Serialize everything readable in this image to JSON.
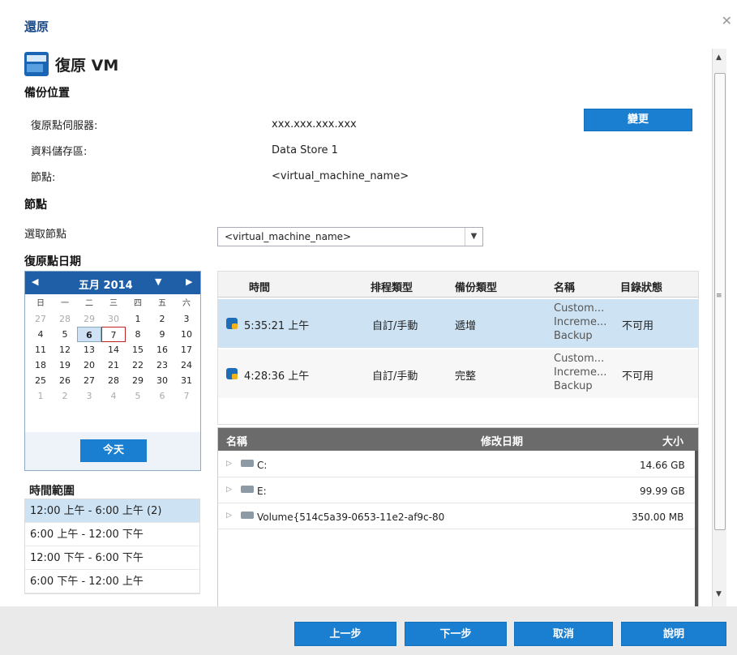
{
  "window": {
    "title": "還原",
    "close_glyph": "✕"
  },
  "header": {
    "title": "復原 VM",
    "icon": "vm-restore-icon"
  },
  "backup_location": {
    "section_title": "備份位置",
    "server_label": "復原點伺服器:",
    "server_value": "xxx.xxx.xxx.xxx",
    "datastore_label": "資料儲存區:",
    "datastore_value": "Data Store 1",
    "node_label": "節點:",
    "node_value": "<virtual_machine_name>",
    "change_button": "變更"
  },
  "node": {
    "section_title": "節點",
    "select_label": "選取節點",
    "selected_value": "<virtual_machine_name>"
  },
  "recovery_date": {
    "section_title": "復原點日期",
    "month_label": "五月 2014",
    "prev_glyph": "◀",
    "next_glyph": "▶",
    "dropdown_glyph": "▼",
    "weekdays": [
      "日",
      "一",
      "二",
      "三",
      "四",
      "五",
      "六"
    ],
    "weeks": [
      [
        "27",
        "28",
        "29",
        "30",
        "1",
        "2",
        "3"
      ],
      [
        "4",
        "5",
        "6",
        "7",
        "8",
        "9",
        "10"
      ],
      [
        "11",
        "12",
        "13",
        "14",
        "15",
        "16",
        "17"
      ],
      [
        "18",
        "19",
        "20",
        "21",
        "22",
        "23",
        "24"
      ],
      [
        "25",
        "26",
        "27",
        "28",
        "29",
        "30",
        "31"
      ],
      [
        "1",
        "2",
        "3",
        "4",
        "5",
        "6",
        "7"
      ]
    ],
    "selected_day": "6",
    "today_day": "7",
    "today_button": "今天"
  },
  "time_range": {
    "title": "時間範圍",
    "items": [
      "12:00 上午 - 6:00 上午  (2)",
      "6:00 上午 - 12:00 下午",
      "12:00 下午 - 6:00 下午",
      "6:00 下午 - 12:00 上午"
    ]
  },
  "recovery_points": {
    "columns": [
      "時間",
      "排程類型",
      "備份類型",
      "名稱",
      "目錄狀態"
    ],
    "rows": [
      {
        "time": "5:35:21 上午",
        "schedule": "自訂/手動",
        "backup_type": "遞增",
        "name_l1": "Custom...",
        "name_l2": "Increme...",
        "name_l3": "Backup",
        "catalog": "不可用"
      },
      {
        "time": "4:28:36 上午",
        "schedule": "自訂/手動",
        "backup_type": "完整",
        "name_l1": "Custom...",
        "name_l2": "Increme...",
        "name_l3": "Backup",
        "catalog": "不可用"
      }
    ]
  },
  "files": {
    "columns": [
      "名稱",
      "修改日期",
      "大小"
    ],
    "rows": [
      {
        "name": "C:",
        "size": "14.66 GB"
      },
      {
        "name": "E:",
        "size": "99.99 GB"
      },
      {
        "name": "Volume{514c5a39-0653-11e2-af9c-80",
        "size": "350.00 MB"
      }
    ]
  },
  "footer": {
    "prev": "上一步",
    "next": "下一步",
    "cancel": "取消",
    "help": "說明"
  },
  "colors": {
    "accent": "#1a7fd1",
    "title": "#1a4b8a",
    "selection": "#cde3f3",
    "calendar_head": "#1f5fa8"
  }
}
